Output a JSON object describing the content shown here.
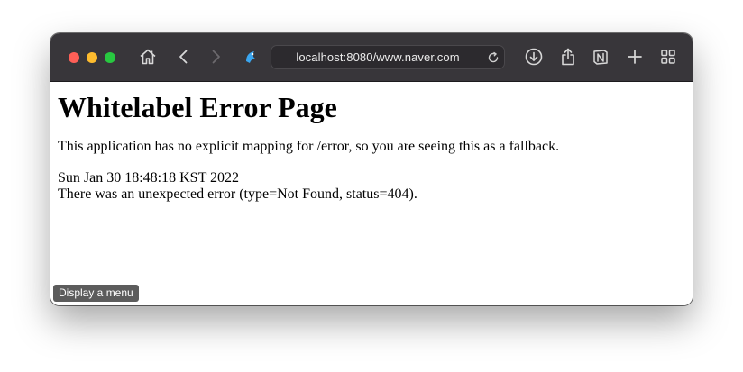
{
  "browser": {
    "url": "localhost:8080/www.naver.com",
    "icons": [
      "home-icon",
      "back-icon",
      "forward-icon",
      "extension-icon",
      "reload-icon",
      "download-icon",
      "share-icon",
      "notion-icon",
      "new-tab-icon",
      "tab-overview-icon"
    ],
    "colors": {
      "toolbar": "#38363a",
      "close": "#fe5f57",
      "minimize": "#febc2e",
      "maximize": "#28c840"
    }
  },
  "page": {
    "title": "Whitelabel Error Page",
    "message": "This application has no explicit mapping for /error, so you are seeing this as a fallback.",
    "timestamp": "Sun Jan 30 18:48:18 KST 2022",
    "error": "There was an unexpected error (type=Not Found, status=404)."
  },
  "tooltip": {
    "label": "Display a menu"
  }
}
